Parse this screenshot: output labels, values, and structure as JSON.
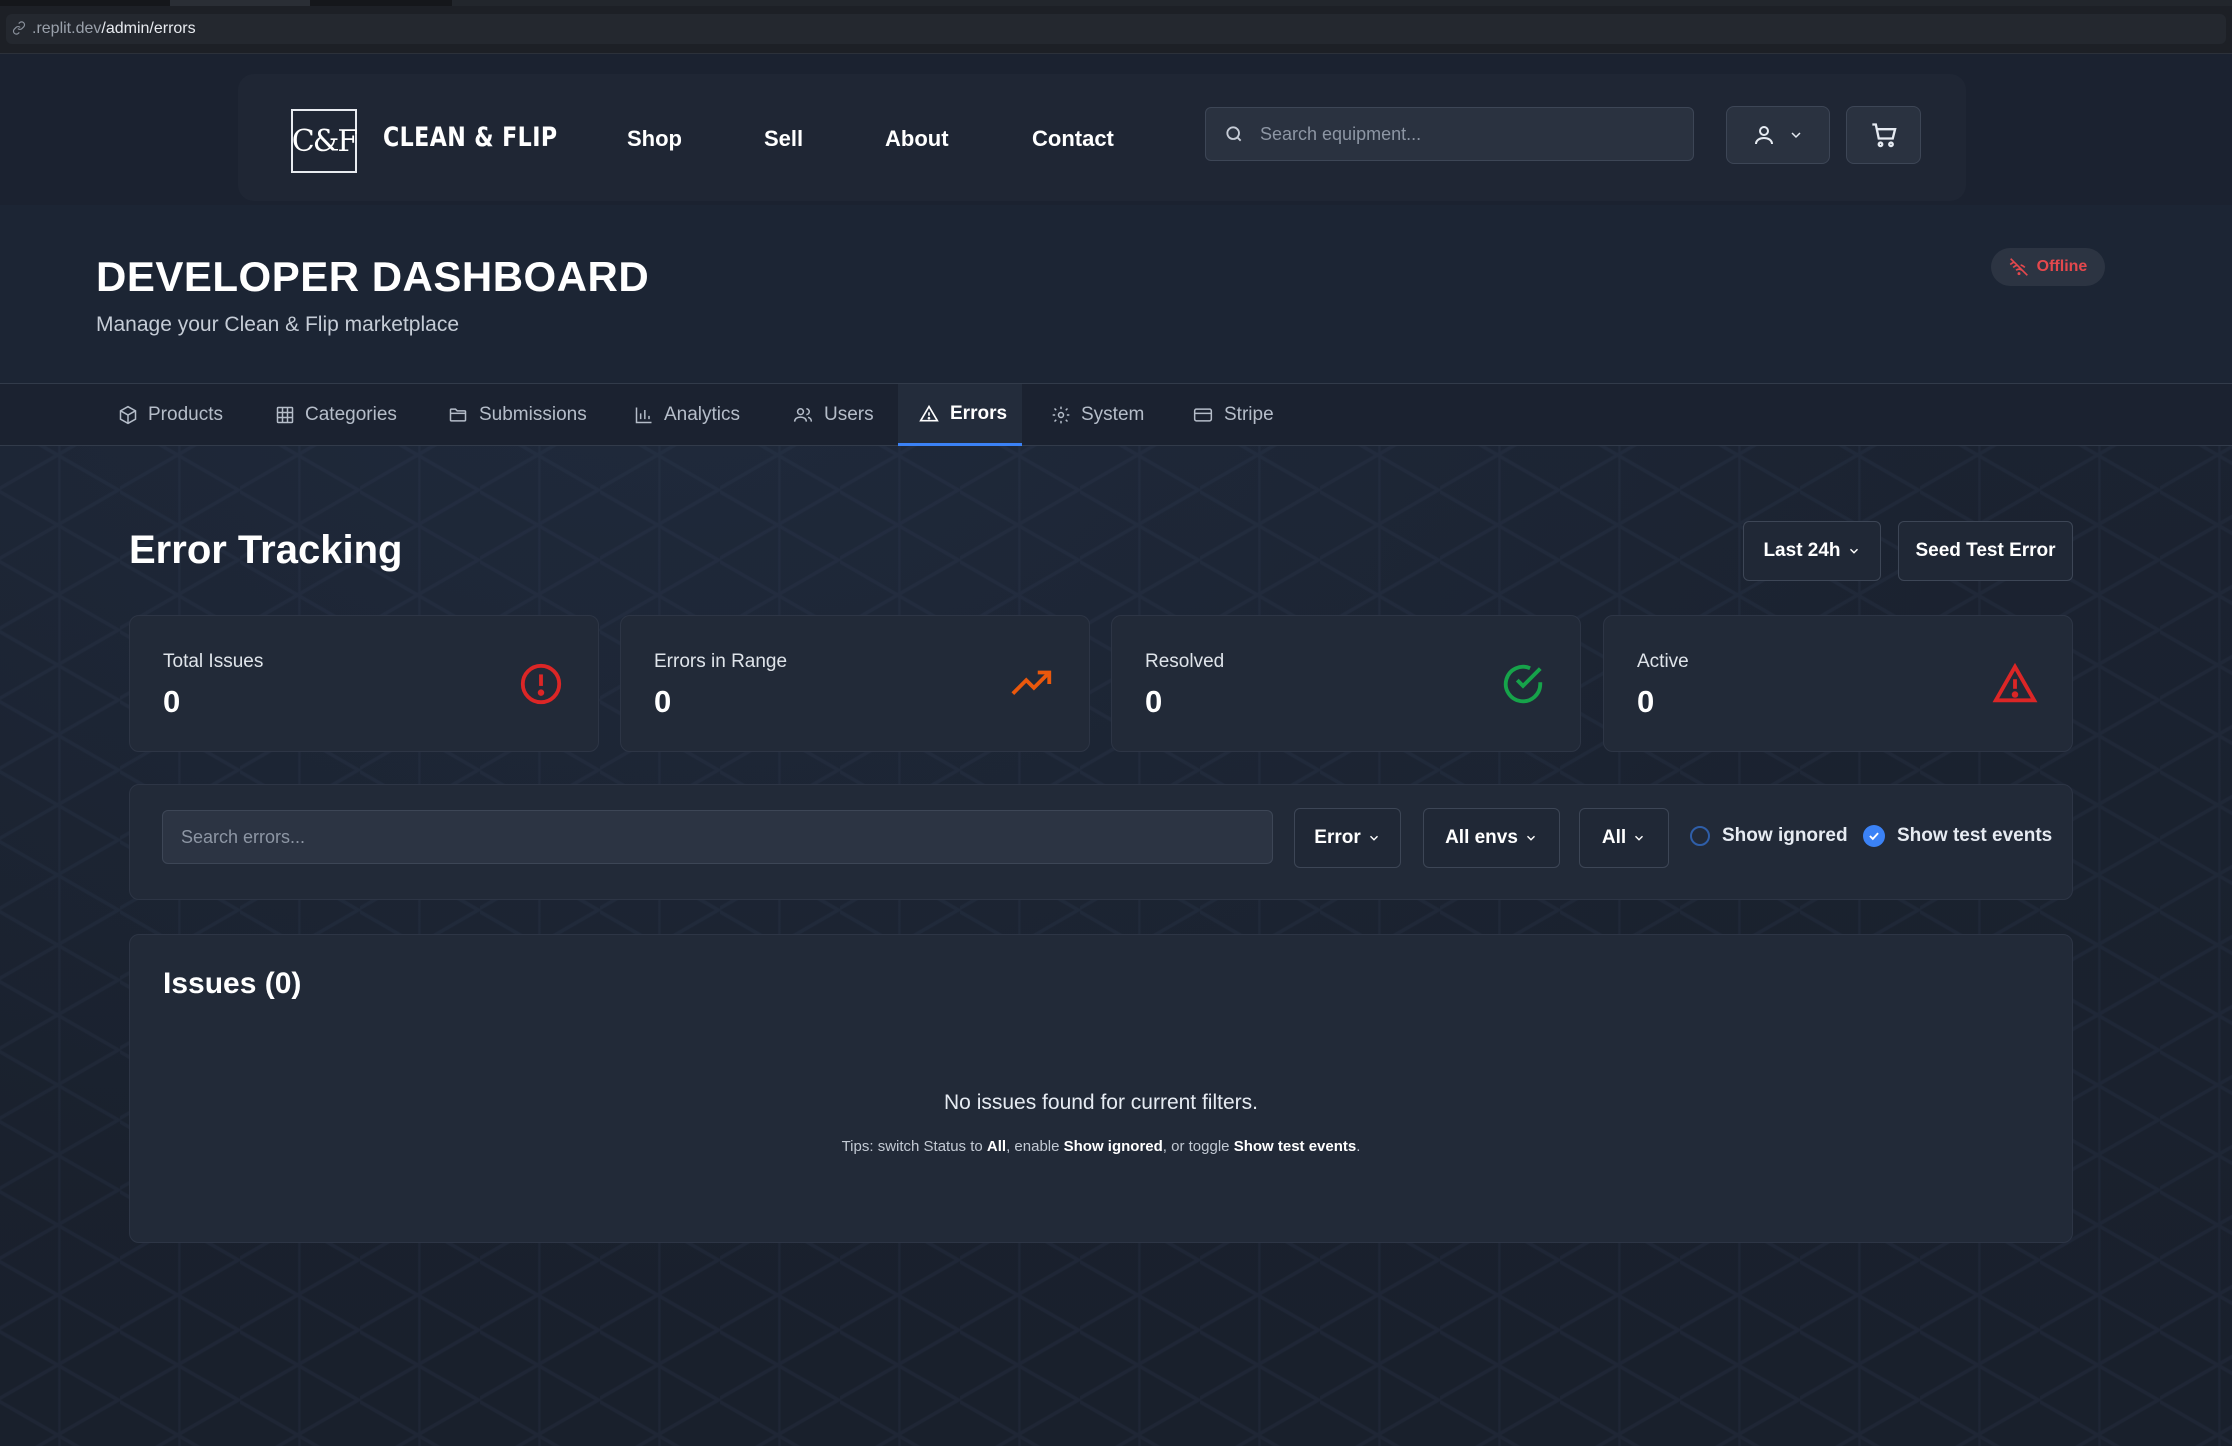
{
  "browser": {
    "url_host": ".replit.dev",
    "url_path": "/admin/errors"
  },
  "nav": {
    "logo_text": "C&F",
    "brand": "CLEAN & FLIP",
    "links": [
      "Shop",
      "Sell",
      "About",
      "Contact"
    ],
    "search_placeholder": "Search equipment..."
  },
  "header": {
    "title": "DEVELOPER DASHBOARD",
    "subtitle": "Manage your Clean & Flip marketplace",
    "status": "Offline"
  },
  "tabs": [
    {
      "label": "Products",
      "icon": "package-icon"
    },
    {
      "label": "Categories",
      "icon": "grid-icon"
    },
    {
      "label": "Submissions",
      "icon": "folder-icon"
    },
    {
      "label": "Analytics",
      "icon": "bar-chart-icon"
    },
    {
      "label": "Users",
      "icon": "users-icon"
    },
    {
      "label": "Errors",
      "icon": "warning-icon",
      "active": true
    },
    {
      "label": "System",
      "icon": "gear-icon"
    },
    {
      "label": "Stripe",
      "icon": "credit-card-icon"
    }
  ],
  "page": {
    "title": "Error Tracking",
    "range_label": "Last 24h",
    "seed_button": "Seed Test Error"
  },
  "stats": [
    {
      "label": "Total Issues",
      "value": "0",
      "icon": "alert-circle-icon",
      "color": "#dc2626"
    },
    {
      "label": "Errors in Range",
      "value": "0",
      "icon": "trending-up-icon",
      "color": "#ea580c"
    },
    {
      "label": "Resolved",
      "value": "0",
      "icon": "check-circle-icon",
      "color": "#16a34a"
    },
    {
      "label": "Active",
      "value": "0",
      "icon": "alert-triangle-icon",
      "color": "#dc2626"
    }
  ],
  "filters": {
    "search_placeholder": "Search errors...",
    "level": "Error",
    "env": "All envs",
    "status": "All",
    "show_ignored": "Show ignored",
    "show_test": "Show test events",
    "show_ignored_checked": false,
    "show_test_checked": true
  },
  "issues": {
    "title": "Issues (0)",
    "empty": "No issues found for current filters.",
    "tips_prefix": "Tips: switch Status to ",
    "tips_all": "All",
    "tips_mid": ", enable ",
    "tips_ignored": "Show ignored",
    "tips_mid2": ", or toggle ",
    "tips_test": "Show test events",
    "tips_end": "."
  },
  "colors": {
    "accent": "#3b82f6",
    "offline": "#e5484d"
  }
}
